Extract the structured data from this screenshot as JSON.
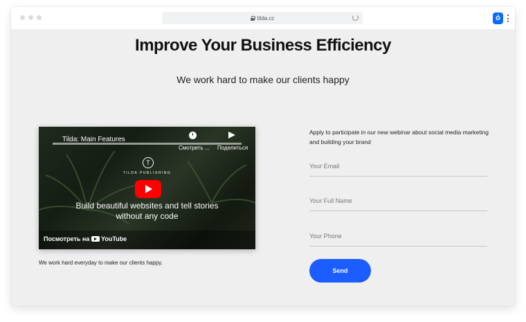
{
  "browser": {
    "url": "tilda.cc",
    "app_badge": "ó"
  },
  "hero": {
    "title": "Improve Your Business Efficiency",
    "subtitle": "We work hard to make our clients happy"
  },
  "video": {
    "title": "Tilda: Main Features",
    "watch_later_label": "Смотреть ...",
    "share_label": "Поделиться",
    "brand": "TILDA PUBLISHING",
    "brand_letter": "T",
    "caption": "Build beautiful websites and tell stories without any code",
    "watch_on": "Посмотреть на",
    "youtube": "YouTube"
  },
  "video_caption": "We work hard everyday to make our clients happy.",
  "form": {
    "intro": "Apply to participate in our new webinar about social media marketing and building your brand",
    "email_placeholder": "Your Email",
    "name_placeholder": "Your Full Name",
    "phone_placeholder": "Your Phone",
    "send_label": "Send"
  },
  "colors": {
    "accent": "#1b5dff",
    "page_bg": "#efefef",
    "play_button": "#ff0000"
  }
}
